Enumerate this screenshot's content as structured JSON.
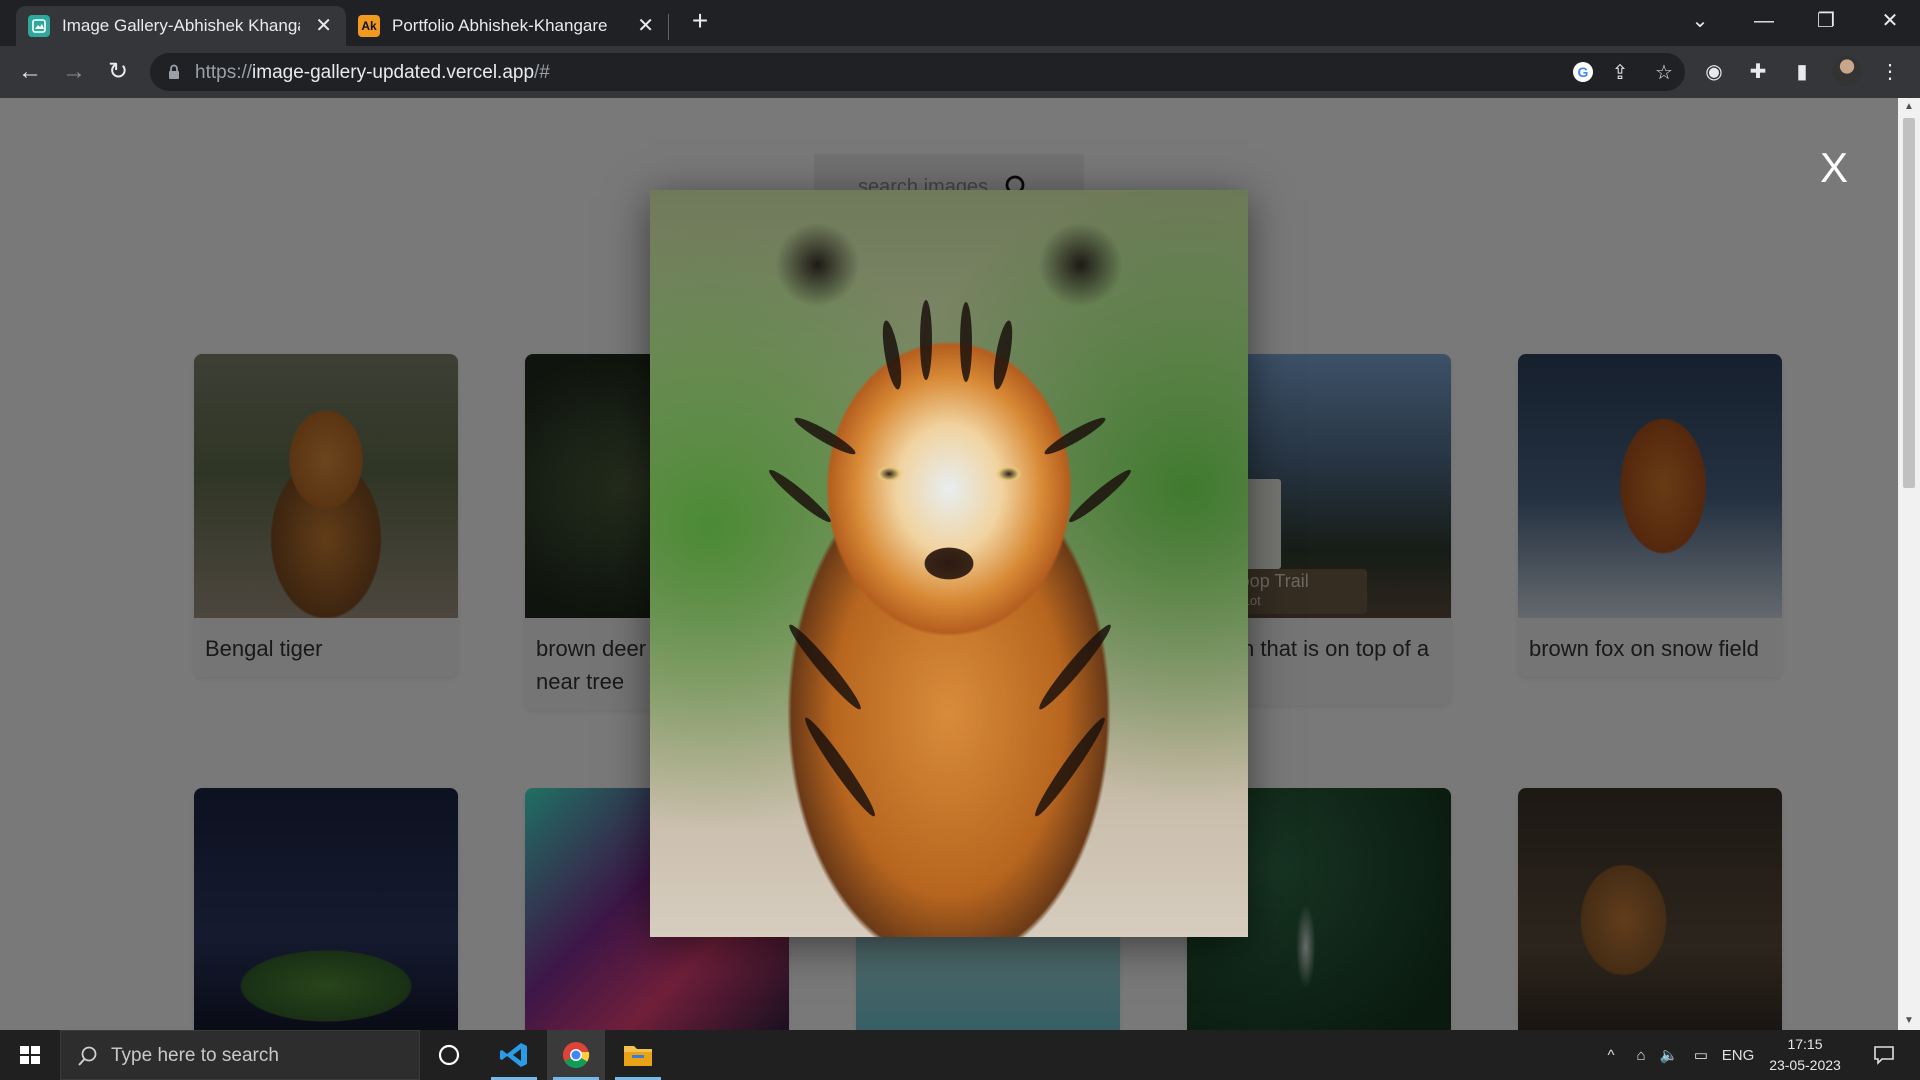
{
  "browser": {
    "tabs": [
      {
        "title": "Image Gallery-Abhishek Khangare",
        "active": true,
        "favicon": "gallery-icon"
      },
      {
        "title": "Portfolio Abhishek-Khangare",
        "active": false,
        "favicon_text": "Ak"
      }
    ],
    "url_scheme": "https://",
    "url_host": "image-gallery-updated.vercel.app",
    "url_path": "/#"
  },
  "page": {
    "search_placeholder": "search images",
    "close_label": "X",
    "cards": [
      {
        "caption": "Bengal tiger",
        "image": "bengal-tiger"
      },
      {
        "caption": "brown deer near tree",
        "image": "brown-deer"
      },
      {
        "caption": "",
        "image": "hidden-behind-lightbox"
      },
      {
        "caption": "n that is on top of a",
        "image": "loop-trail-sign"
      },
      {
        "caption": "brown fox on snow field",
        "image": "brown-fox"
      },
      {
        "caption": "",
        "image": "cricket-stadium"
      },
      {
        "caption": "",
        "image": "neon-corridor"
      },
      {
        "caption": "",
        "image": "pastel-sky"
      },
      {
        "caption": "",
        "image": "airplane-over-forest"
      },
      {
        "caption": "",
        "image": "tiger-sitting"
      }
    ],
    "lightbox_image": "bengal-tiger-large",
    "trail_sign_text": "RW Loop Trail",
    "trail_sign_sub": "Parking Lot"
  },
  "taskbar": {
    "search_placeholder": "Type here to search",
    "language": "ENG",
    "time": "17:15",
    "date": "23-05-2023"
  }
}
